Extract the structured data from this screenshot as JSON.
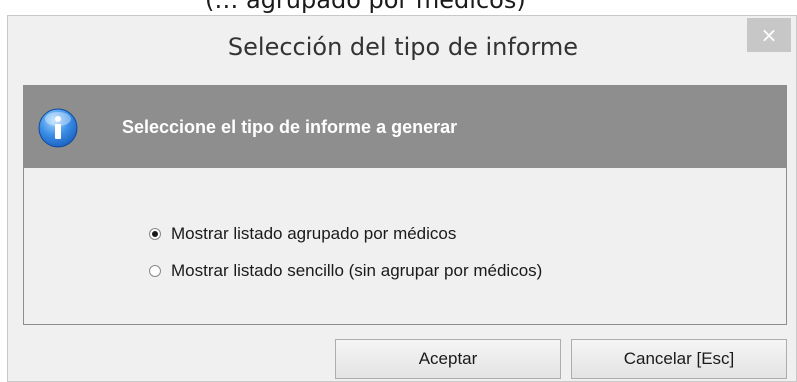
{
  "above_text": "(… agrupado por médicos)",
  "dialog": {
    "title": "Selección del tipo de informe",
    "close_glyph": "×",
    "header": {
      "text": "Seleccione el tipo de informe a generar",
      "icon": "info-icon"
    },
    "options": [
      {
        "label": "Mostrar listado agrupado por médicos",
        "checked": true
      },
      {
        "label": "Mostrar listado sencillo (sin agrupar por médicos)",
        "checked": false
      }
    ],
    "buttons": {
      "accept": "Aceptar",
      "cancel": "Cancelar  [Esc]"
    }
  },
  "colors": {
    "header_band": "#8e8e8e",
    "window_bg": "#f0f0f0",
    "close_button": "#c7c7c7"
  }
}
